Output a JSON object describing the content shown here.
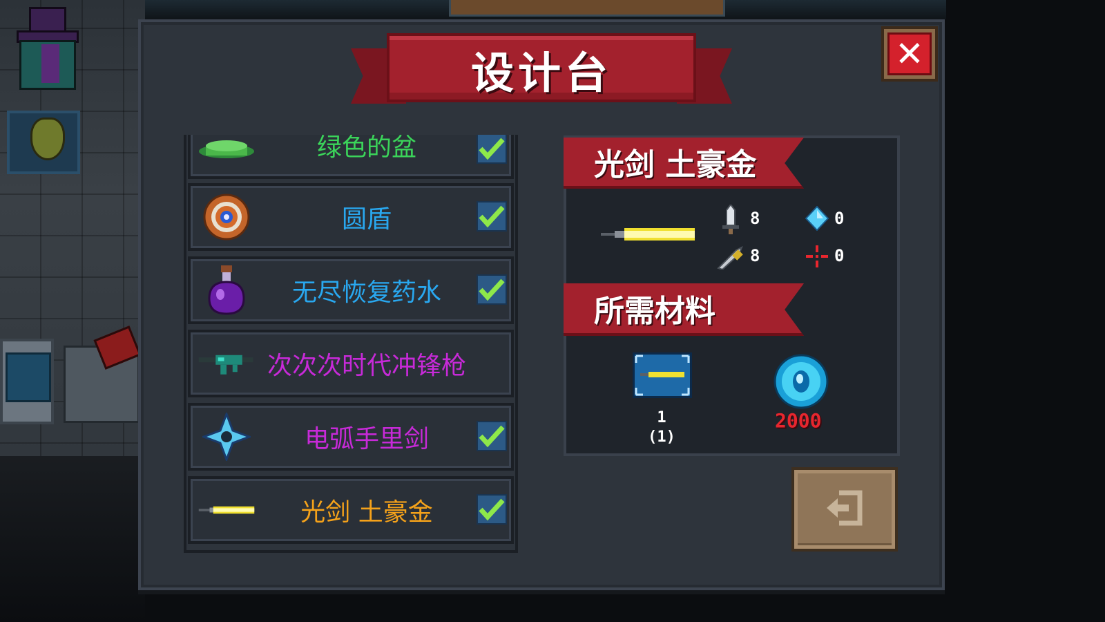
{
  "title": "设计台",
  "close_icon": "close-x-icon",
  "recipes": [
    {
      "name": "绿色的盆",
      "icon": "green-bowl-icon",
      "color": "#3bd45a",
      "checked": true
    },
    {
      "name": "圆盾",
      "icon": "round-shield-icon",
      "color": "#29a8f0",
      "checked": true
    },
    {
      "name": "无尽恢复药水",
      "icon": "potion-icon",
      "color": "#29a8f0",
      "checked": true
    },
    {
      "name": "次次次时代冲锋枪",
      "icon": "smg-icon",
      "color": "#c72ad8",
      "checked": false
    },
    {
      "name": "电弧手里剑",
      "icon": "shuriken-icon",
      "color": "#c72ad8",
      "checked": true
    },
    {
      "name": "光剑 土豪金",
      "icon": "lightsaber-icon",
      "color": "#f5a21a",
      "checked": true
    }
  ],
  "detail": {
    "name": "光剑 土豪金",
    "weapon_icon": "lightsaber-icon",
    "stats": {
      "damage": {
        "icon": "sword-icon",
        "value": "8"
      },
      "energy": {
        "icon": "diamond-icon",
        "value": "0"
      },
      "crit": {
        "icon": "knife-icon",
        "value": "8"
      },
      "accuracy": {
        "icon": "crosshair-icon",
        "value": "0"
      }
    },
    "materials_header": "所需材料",
    "materials": [
      {
        "icon": "blueprint-icon",
        "count_top": "1",
        "count_bottom": "(1)"
      },
      {
        "icon": "gem-coin-icon",
        "cost": "2000"
      }
    ]
  },
  "exit_icon": "exit-icon",
  "colors": {
    "ribbon": "#a3212d",
    "panel": "#2e343c",
    "cost": "#e8262e",
    "check": "#8ee84a"
  }
}
